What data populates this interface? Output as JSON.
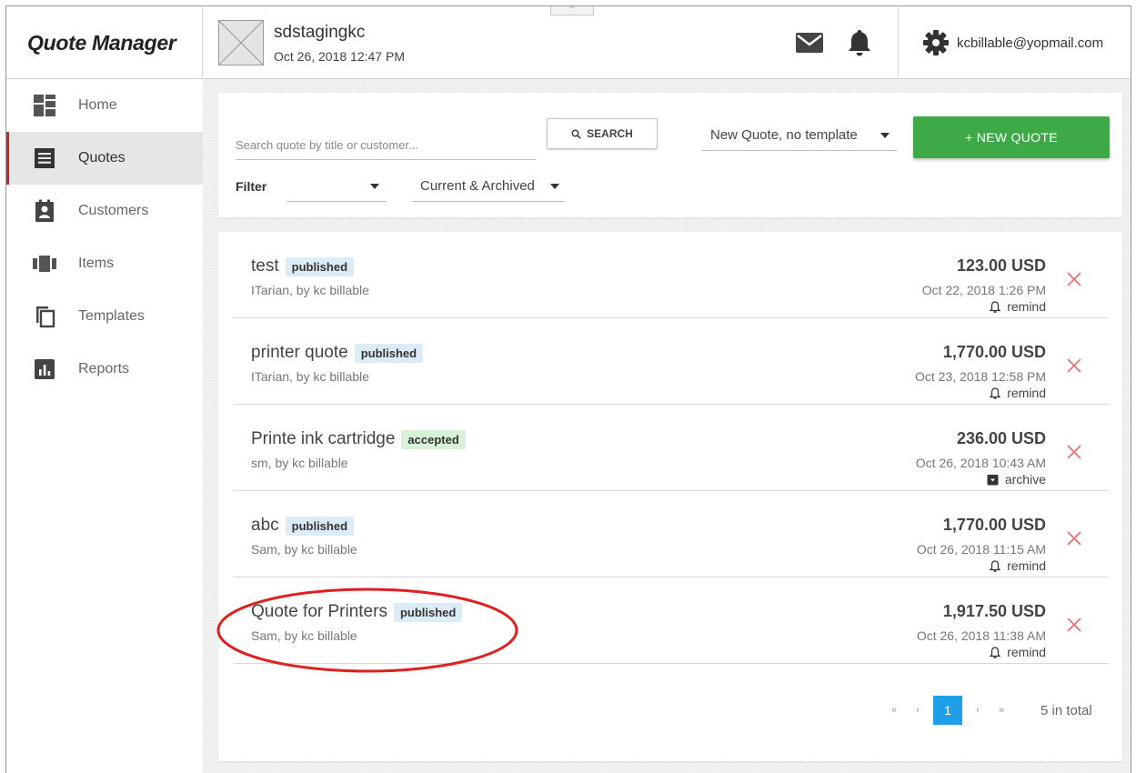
{
  "app": {
    "brand": "Quote Manager"
  },
  "header": {
    "company_name": "sdstagingkc",
    "company_date": "Oct 26, 2018 12:47 PM",
    "user_email": "kcbillable@yopmail.com",
    "collapse_glyph": "^"
  },
  "sidebar": {
    "items": [
      {
        "label": "Home",
        "icon": "home-icon",
        "active": false
      },
      {
        "label": "Quotes",
        "icon": "quotes-icon",
        "active": true
      },
      {
        "label": "Customers",
        "icon": "customers-icon",
        "active": false
      },
      {
        "label": "Items",
        "icon": "items-icon",
        "active": false
      },
      {
        "label": "Templates",
        "icon": "templates-icon",
        "active": false
      },
      {
        "label": "Reports",
        "icon": "reports-icon",
        "active": false
      }
    ]
  },
  "toolbar": {
    "search_placeholder": "Search quote by title or customer...",
    "search_label": "SEARCH",
    "template_select_value": "New Quote, no template",
    "new_quote_label": "+ NEW QUOTE",
    "filter_label": "Filter",
    "filter_value": "",
    "archive_select_value": "Current & Archived"
  },
  "quotes": [
    {
      "title": "test",
      "status": "published",
      "customer": "ITarian, by kc billable",
      "amount": "123.00 USD",
      "date": "Oct 22, 2018 1:26 PM",
      "action": "remind"
    },
    {
      "title": "printer quote",
      "status": "published",
      "customer": "ITarian, by kc billable",
      "amount": "1,770.00 USD",
      "date": "Oct 23, 2018 12:58 PM",
      "action": "remind"
    },
    {
      "title": "Printe ink cartridge",
      "status": "accepted",
      "customer": "sm, by kc billable",
      "amount": "236.00 USD",
      "date": "Oct 26, 2018 10:43 AM",
      "action": "archive"
    },
    {
      "title": "abc",
      "status": "published",
      "customer": "Sam, by kc billable",
      "amount": "1,770.00 USD",
      "date": "Oct 26, 2018 11:15 AM",
      "action": "remind"
    },
    {
      "title": "Quote for Printers",
      "status": "published",
      "customer": "Sam, by kc billable",
      "amount": "1,917.50 USD",
      "date": "Oct 26, 2018 11:38 AM",
      "action": "remind"
    }
  ],
  "pagination": {
    "first": "«",
    "prev": "‹",
    "current": "1",
    "next": "›",
    "last": "»",
    "total": "5 in total"
  },
  "colors": {
    "accent_green": "#3daa47",
    "active_marker": "#c62828",
    "page_current": "#1e9fe8",
    "delete": "#e57373",
    "highlight": "#e02020"
  }
}
